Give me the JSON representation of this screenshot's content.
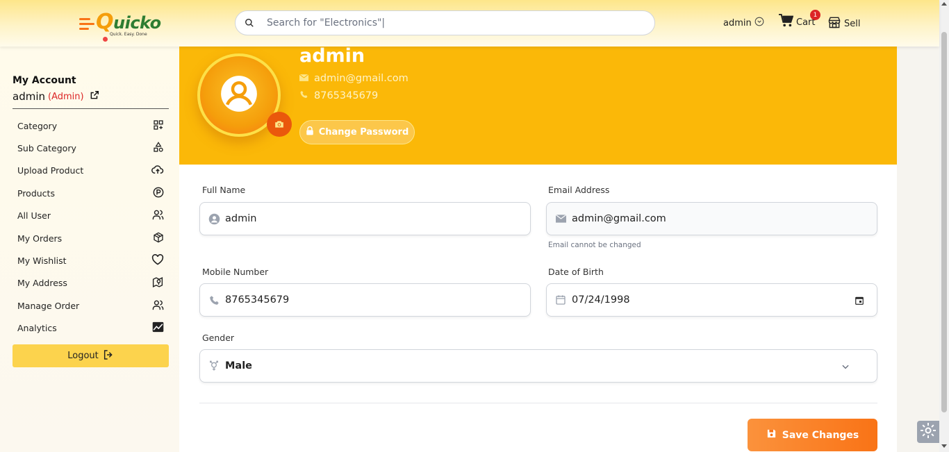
{
  "header": {
    "logo_text": "Quicko",
    "logo_tagline": "Quick. Easy. Done",
    "search_placeholder": "Search for \"Electronics\"|",
    "user_label": "admin",
    "cart_label": "Cart",
    "cart_count": "1",
    "sell_label": "Sell"
  },
  "sidebar": {
    "title": "My Account",
    "username": "admin",
    "role": "(Admin)",
    "items": [
      {
        "label": "Category",
        "icon": "category-grid-icon"
      },
      {
        "label": "Sub Category",
        "icon": "shapes-icon"
      },
      {
        "label": "Upload Product",
        "icon": "cloud-upload-icon"
      },
      {
        "label": "Products",
        "icon": "product-circle-icon"
      },
      {
        "label": "All User",
        "icon": "users-icon"
      },
      {
        "label": "My Orders",
        "icon": "package-icon"
      },
      {
        "label": "My Wishlist",
        "icon": "heart-icon"
      },
      {
        "label": "My Address",
        "icon": "map-pin-icon"
      },
      {
        "label": "Manage Order",
        "icon": "users-icon"
      },
      {
        "label": "Analytics",
        "icon": "chart-icon"
      }
    ],
    "logout_label": "Logout"
  },
  "profile": {
    "name": "admin",
    "email": "admin@gmail.com",
    "phone": "8765345679",
    "change_password_label": "Change Password"
  },
  "form": {
    "full_name_label": "Full Name",
    "full_name_value": "admin",
    "email_label": "Email Address",
    "email_value": "admin@gmail.com",
    "email_hint": "Email cannot be changed",
    "mobile_label": "Mobile Number",
    "mobile_value": "8765345679",
    "dob_label": "Date of Birth",
    "dob_value": "07/24/1998",
    "gender_label": "Gender",
    "gender_value": "Male",
    "save_label": "Save Changes"
  },
  "colors": {
    "banner": "#fbb808",
    "accent": "#f97316",
    "logout_bg": "#fcd34d"
  }
}
